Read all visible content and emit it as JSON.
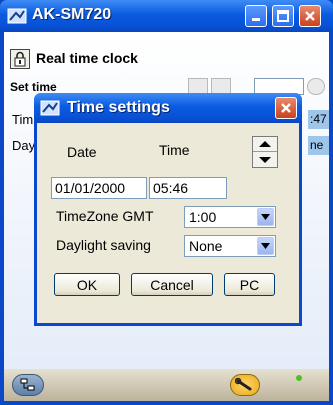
{
  "window": {
    "title": "AK-SM720",
    "minimize_icon": "minimize-icon",
    "maximize_icon": "maximize-icon",
    "close_icon": "close-icon"
  },
  "header": {
    "title": "Real time clock",
    "lock_icon": "lock-icon"
  },
  "background": {
    "set_time_label": "Set time",
    "time_row_label": "Tim",
    "time_row_value": ":47",
    "day_row_label": "Day",
    "day_row_value": "ne"
  },
  "dialog": {
    "title": "Time settings",
    "date_header": "Date",
    "time_header": "Time",
    "date_value": "01/01/2000",
    "time_value": "05:46",
    "timezone_label": "TimeZone GMT",
    "timezone_value": "1:00",
    "daylight_label": "Daylight saving",
    "daylight_value": "None",
    "ok_label": "OK",
    "cancel_label": "Cancel",
    "pc_label": "PC"
  },
  "colors": {
    "titlebar": "#0b5be1",
    "dialog_face": "#ece9d8",
    "close_red": "#c8421e"
  }
}
